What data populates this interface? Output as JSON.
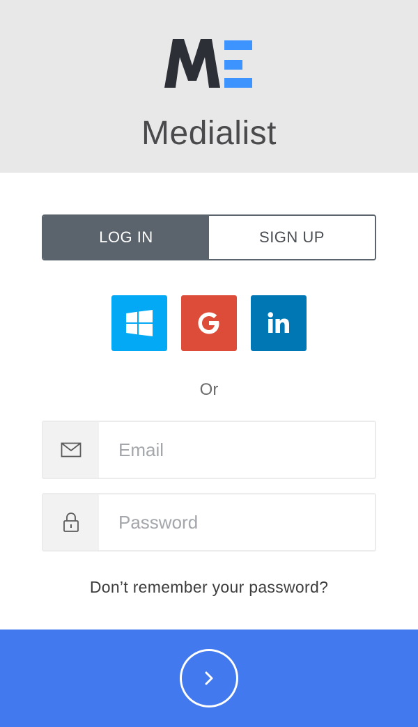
{
  "brand": {
    "logo_text": "ME",
    "app_name": "Medialist",
    "logo_dark_color": "#2d2f36",
    "logo_accent_color": "#3d94ff"
  },
  "tabs": [
    {
      "label": "LOG IN",
      "active": true
    },
    {
      "label": "SIGN UP",
      "active": false
    }
  ],
  "social_buttons": [
    {
      "icon": "windows-icon",
      "color": "#03a9f4"
    },
    {
      "icon": "google-icon",
      "color": "#dd4b39"
    },
    {
      "icon": "linkedin-icon",
      "color": "#0077b5"
    }
  ],
  "divider_text": "Or",
  "form": {
    "email": {
      "placeholder": "Email",
      "value": "",
      "icon": "envelope-icon"
    },
    "password": {
      "placeholder": "Password",
      "value": "",
      "icon": "lock-icon"
    }
  },
  "forgot_password_label": "Don’t remember your password?",
  "submit": {
    "icon": "chevron-right-icon",
    "color": "#4379ef"
  }
}
